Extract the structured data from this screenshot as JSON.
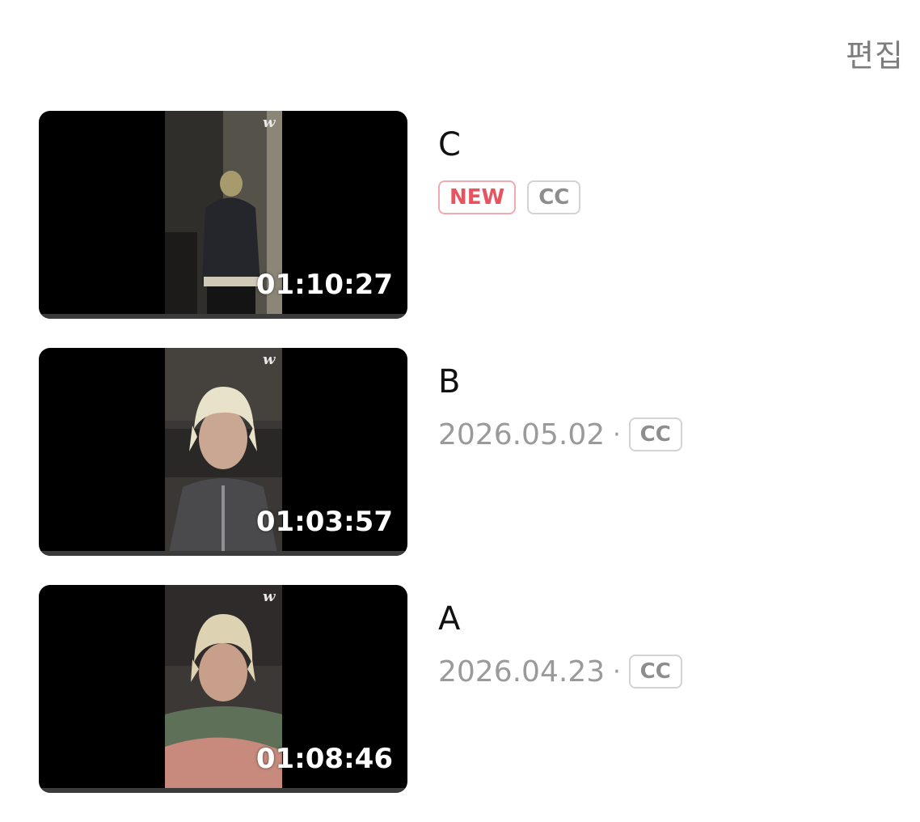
{
  "header": {
    "edit_label": "편집"
  },
  "videos": [
    {
      "title": "C",
      "duration": "01:10:27",
      "date": "",
      "is_new": true,
      "new_label": "NEW",
      "cc_label": "CC",
      "logo": "w"
    },
    {
      "title": "B",
      "duration": "01:03:57",
      "date": "2026.05.02",
      "is_new": false,
      "cc_label": "CC",
      "logo": "w"
    },
    {
      "title": "A",
      "duration": "01:08:46",
      "date": "2026.04.23",
      "is_new": false,
      "cc_label": "CC",
      "logo": "w"
    }
  ],
  "colors": {
    "new_badge_text": "#e8535f",
    "new_badge_border": "#f1aab0",
    "cc_badge_text": "#8d8d8d",
    "meta_text": "#9a9a9a",
    "edit_text": "#7d7d7d"
  }
}
